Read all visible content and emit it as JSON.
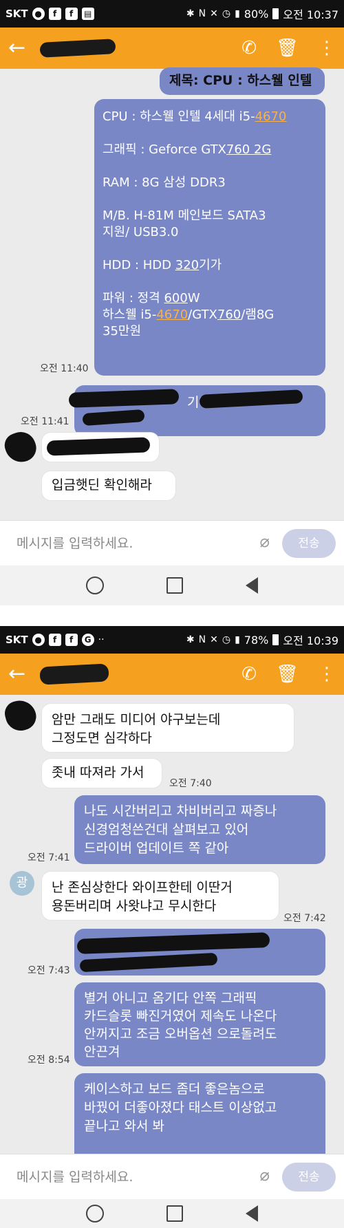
{
  "screen1": {
    "status": {
      "carrier": "SKT",
      "battery": "80%",
      "time": "오전 10:37"
    },
    "subject": "제목: CPU : 하스웰 인텔",
    "spec": {
      "cpu_a": "CPU : 하스웰 인텔 4세대  i5-",
      "cpu_b": "4670",
      "gpu_a": "그래픽 : Geforce GTX",
      "gpu_b": "760 2G",
      "ram": "RAM : 8G  삼성 DDR3",
      "mb1": "M/B.  H-81M  메인보드 SATA3",
      "mb2": "지원/ USB3.0",
      "hdd_a": "HDD :  HDD ",
      "hdd_b": "320",
      "hdd_c": "기가",
      "psu_a": "파워 : 정격 ",
      "psu_b": "600",
      "psu_c": "W",
      "sum_a": "하스웰 i5-",
      "sum_b": "4670",
      "sum_c": "/GTX",
      "sum_d": "760",
      "sum_e": "/램8G",
      "price": "35만원"
    },
    "time_spec": "오전 11:40",
    "redacted_frag": "기억",
    "time_redacted": "오전 11:41",
    "incoming": "입금햇딘 확인해라",
    "input_placeholder": "메시지를 입력하세요.",
    "send_label": "전송"
  },
  "screen2": {
    "status": {
      "carrier": "SKT",
      "battery": "78%",
      "time": "오전 10:39"
    },
    "msg1": [
      "암만 그래도  미디어 야구보는데",
      "그정도면 심각하다"
    ],
    "msg2": "좃내 따져라 가서",
    "time2": "오전 7:40",
    "msg3": [
      "나도 시간버리고 차비버리고 짜증나",
      "신경엄청쓴건대 살펴보고 있어",
      "드라이버 업데이트 쪽 같아"
    ],
    "time3": "오전 7:41",
    "avatar_char": "광",
    "msg4": [
      "난 존심상한다 와이프한테 이딴거",
      "용돈버리며 사왓냐고 무시한다"
    ],
    "time4": "오전 7:42",
    "time5": "오전 7:43",
    "msg6": [
      "별거 아니고 옴기다 안쪽 그래픽",
      "카드슬롯 빠진거였어 제속도 나온다",
      "안꺼지고 조금 오버옵션 으로돌려도",
      "안끈겨"
    ],
    "time6": "오전 8:54",
    "msg7": [
      "케이스하고 보드 좀더 좋은놈으로",
      "바꿨어 더좋아졌다 태스트 이상없고",
      "끝나고 와서 봐"
    ],
    "input_placeholder": "메시지를 입력하세요.",
    "send_label": "전송"
  },
  "colors": {
    "appbar": "#f5a01e",
    "outgoing": "#7a87c6",
    "highlight": "#f7b24a",
    "chat_bg": "#ebebeb"
  }
}
